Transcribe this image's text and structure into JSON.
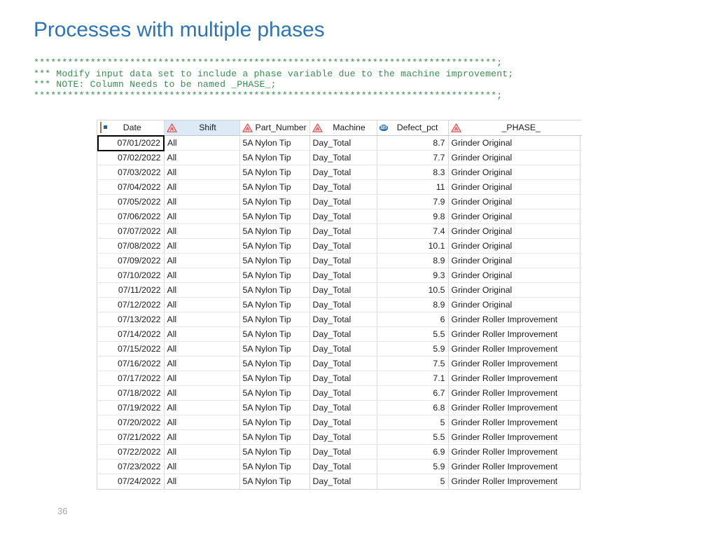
{
  "slide": {
    "title": "Processes with multiple phases",
    "page_number": "36",
    "title_color": "#2E74B5",
    "code_color": "#3B8C53"
  },
  "code": {
    "lines": [
      "**********************************************************************************;",
      "*** Modify input data set to include a phase variable due to the machine improvement;",
      "*** NOTE: Column Needs to be named _PHASE_;",
      "**********************************************************************************;"
    ]
  },
  "table": {
    "columns": [
      {
        "label": "Date",
        "icon": "calendar-icon",
        "type": "date",
        "align": "right",
        "selected": false
      },
      {
        "label": "Shift",
        "icon": "character-icon",
        "type": "character",
        "align": "left",
        "selected": true
      },
      {
        "label": "Part_Number",
        "icon": "character-icon",
        "type": "character",
        "align": "left",
        "selected": false
      },
      {
        "label": "Machine",
        "icon": "character-icon",
        "type": "character",
        "align": "left",
        "selected": false
      },
      {
        "label": "Defect_pct",
        "icon": "numeric-icon",
        "type": "numeric",
        "align": "right",
        "selected": false
      },
      {
        "label": "_PHASE_",
        "icon": "character-icon",
        "type": "character",
        "align": "left",
        "selected": false
      }
    ],
    "active_cell": {
      "row": 0,
      "col": 0
    },
    "rows": [
      [
        "07/01/2022",
        "All",
        "5A Nylon Tip",
        "Day_Total",
        "8.7",
        "Grinder Original"
      ],
      [
        "07/02/2022",
        "All",
        "5A Nylon Tip",
        "Day_Total",
        "7.7",
        "Grinder Original"
      ],
      [
        "07/03/2022",
        "All",
        "5A Nylon Tip",
        "Day_Total",
        "8.3",
        "Grinder Original"
      ],
      [
        "07/04/2022",
        "All",
        "5A Nylon Tip",
        "Day_Total",
        "11",
        "Grinder Original"
      ],
      [
        "07/05/2022",
        "All",
        "5A Nylon Tip",
        "Day_Total",
        "7.9",
        "Grinder Original"
      ],
      [
        "07/06/2022",
        "All",
        "5A Nylon Tip",
        "Day_Total",
        "9.8",
        "Grinder Original"
      ],
      [
        "07/07/2022",
        "All",
        "5A Nylon Tip",
        "Day_Total",
        "7.4",
        "Grinder Original"
      ],
      [
        "07/08/2022",
        "All",
        "5A Nylon Tip",
        "Day_Total",
        "10.1",
        "Grinder Original"
      ],
      [
        "07/09/2022",
        "All",
        "5A Nylon Tip",
        "Day_Total",
        "8.9",
        "Grinder Original"
      ],
      [
        "07/10/2022",
        "All",
        "5A Nylon Tip",
        "Day_Total",
        "9.3",
        "Grinder Original"
      ],
      [
        "07/11/2022",
        "All",
        "5A Nylon Tip",
        "Day_Total",
        "10.5",
        "Grinder Original"
      ],
      [
        "07/12/2022",
        "All",
        "5A Nylon Tip",
        "Day_Total",
        "8.9",
        "Grinder Original"
      ],
      [
        "07/13/2022",
        "All",
        "5A Nylon Tip",
        "Day_Total",
        "6",
        "Grinder Roller Improvement"
      ],
      [
        "07/14/2022",
        "All",
        "5A Nylon Tip",
        "Day_Total",
        "5.5",
        "Grinder Roller Improvement"
      ],
      [
        "07/15/2022",
        "All",
        "5A Nylon Tip",
        "Day_Total",
        "5.9",
        "Grinder Roller Improvement"
      ],
      [
        "07/16/2022",
        "All",
        "5A Nylon Tip",
        "Day_Total",
        "7.5",
        "Grinder Roller Improvement"
      ],
      [
        "07/17/2022",
        "All",
        "5A Nylon Tip",
        "Day_Total",
        "7.1",
        "Grinder Roller Improvement"
      ],
      [
        "07/18/2022",
        "All",
        "5A Nylon Tip",
        "Day_Total",
        "6.7",
        "Grinder Roller Improvement"
      ],
      [
        "07/19/2022",
        "All",
        "5A Nylon Tip",
        "Day_Total",
        "6.8",
        "Grinder Roller Improvement"
      ],
      [
        "07/20/2022",
        "All",
        "5A Nylon Tip",
        "Day_Total",
        "5",
        "Grinder Roller Improvement"
      ],
      [
        "07/21/2022",
        "All",
        "5A Nylon Tip",
        "Day_Total",
        "5.5",
        "Grinder Roller Improvement"
      ],
      [
        "07/22/2022",
        "All",
        "5A Nylon Tip",
        "Day_Total",
        "6.9",
        "Grinder Roller Improvement"
      ],
      [
        "07/23/2022",
        "All",
        "5A Nylon Tip",
        "Day_Total",
        "5.9",
        "Grinder Roller Improvement"
      ],
      [
        "07/24/2022",
        "All",
        "5A Nylon Tip",
        "Day_Total",
        "5",
        "Grinder Roller Improvement"
      ]
    ]
  }
}
